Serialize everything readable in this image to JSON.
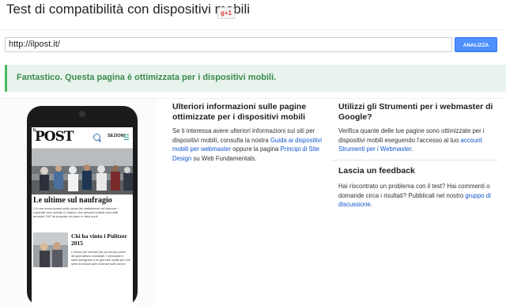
{
  "header": {
    "title": "Test di compatibilità con dispositivi mobili",
    "gplus_label": "g+1"
  },
  "url_bar": {
    "value": "http://ilpost.it/",
    "analyze_label": "ANALIZZA"
  },
  "result": {
    "message": "Fantastico. Questa pagina è ottimizzata per i dispositivi mobili."
  },
  "preview": {
    "logo_small": "IL",
    "logo": "POST",
    "sections_label": "SEZIONI",
    "headline1": "Le ultime sul naufragio",
    "text1": "C'è una nuova ipotesi sulla causa del ribaltamento del barcone, i superstiti sono arrivati a Catania, due presunti scafisti sono stati arrestati, l'UE ha proposto un piano in dieci punti",
    "headline2": "Chi ha vinto i Pulitzer 2015",
    "text2": "L'elenco dei vincitori dei più famosi premi del giornalismo mondiale: il principale è stato assegnato a un giornale locale per una serie di articoli sulle violenze sulle donne"
  },
  "info_column": {
    "title": "Ulteriori informazioni sulle pagine ottimizzate per i dispositivi mobili",
    "body_start": "Se ti interessa avere ulteriori informazioni sui siti per dispositivi mobili, consulta la nostra ",
    "link1": "Guida ai dispositivi mobili per webmaster",
    "body_mid": " oppure la pagina ",
    "link2": "Principi di Site Design",
    "body_end": " su Web Fundamentals."
  },
  "tools_column": {
    "title": "Utilizzi gli Strumenti per i webmaster di Google?",
    "body_start": "Verifica quante delle tue pagine sono ottimizzate per i dispositivi mobili eseguendo l'accesso al tuo ",
    "link": "account Strumenti per i Webmaster",
    "body_end": "."
  },
  "feedback": {
    "title": "Lascia un feedback",
    "body_start": "Hai riscontrato un problema con il test? Hai commenti o domande circa i risultati? Pubblicali nel nostro ",
    "link": "gruppo di discussione",
    "body_end": "."
  },
  "colors": {
    "accent_blue": "#4d90fe",
    "success_green": "#3d8a4f",
    "link": "#1155cc"
  }
}
